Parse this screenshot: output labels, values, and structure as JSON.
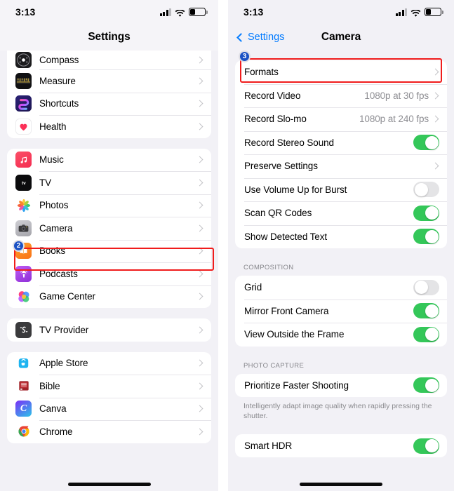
{
  "left_phone": {
    "status": {
      "time": "3:13",
      "signal_icon": "cellular-bars-icon",
      "wifi_icon": "wifi-icon",
      "battery_icon": "battery-low-icon"
    },
    "nav": {
      "title": "Settings"
    },
    "groups": [
      {
        "rows": [
          {
            "label": "Compass",
            "icon": "compass-app-icon",
            "partial": true
          },
          {
            "label": "Measure",
            "icon": "measure-app-icon"
          },
          {
            "label": "Shortcuts",
            "icon": "shortcuts-app-icon"
          },
          {
            "label": "Health",
            "icon": "health-app-icon"
          }
        ]
      },
      {
        "rows": [
          {
            "label": "Music",
            "icon": "music-app-icon"
          },
          {
            "label": "TV",
            "icon": "tv-app-icon"
          },
          {
            "label": "Photos",
            "icon": "photos-app-icon"
          },
          {
            "label": "Camera",
            "icon": "camera-app-icon",
            "highlighted": true
          },
          {
            "label": "Books",
            "icon": "books-app-icon"
          },
          {
            "label": "Podcasts",
            "icon": "podcasts-app-icon"
          },
          {
            "label": "Game Center",
            "icon": "game-center-app-icon"
          }
        ]
      },
      {
        "rows": [
          {
            "label": "TV Provider",
            "icon": "tv-provider-app-icon"
          }
        ]
      },
      {
        "rows": [
          {
            "label": "Apple Store",
            "icon": "apple-store-app-icon"
          },
          {
            "label": "Bible",
            "icon": "bible-app-icon"
          },
          {
            "label": "Canva",
            "icon": "canva-app-icon"
          },
          {
            "label": "Chrome",
            "icon": "chrome-app-icon"
          }
        ]
      }
    ],
    "badge": "2"
  },
  "right_phone": {
    "status": {
      "time": "3:13",
      "signal_icon": "cellular-bars-icon",
      "wifi_icon": "wifi-icon",
      "battery_icon": "battery-low-icon"
    },
    "nav": {
      "back_label": "Settings",
      "title": "Camera"
    },
    "badge": "3",
    "group1": [
      {
        "label": "Formats",
        "type": "disclosure",
        "highlighted": true
      },
      {
        "label": "Record Video",
        "type": "value",
        "value": "1080p at 30 fps"
      },
      {
        "label": "Record Slo-mo",
        "type": "value",
        "value": "1080p at 240 fps"
      },
      {
        "label": "Record Stereo Sound",
        "type": "toggle",
        "on": true
      },
      {
        "label": "Preserve Settings",
        "type": "disclosure"
      },
      {
        "label": "Use Volume Up for Burst",
        "type": "toggle",
        "on": false
      },
      {
        "label": "Scan QR Codes",
        "type": "toggle",
        "on": true
      },
      {
        "label": "Show Detected Text",
        "type": "toggle",
        "on": true
      }
    ],
    "section_composition": "COMPOSITION",
    "group2": [
      {
        "label": "Grid",
        "type": "toggle",
        "on": false
      },
      {
        "label": "Mirror Front Camera",
        "type": "toggle",
        "on": true
      },
      {
        "label": "View Outside the Frame",
        "type": "toggle",
        "on": true
      }
    ],
    "section_photo_capture": "PHOTO CAPTURE",
    "group3": [
      {
        "label": "Prioritize Faster Shooting",
        "type": "toggle",
        "on": true
      }
    ],
    "footnote": "Intelligently adapt image quality when rapidly pressing the shutter.",
    "group4": [
      {
        "label": "Smart HDR",
        "type": "toggle",
        "on": true
      }
    ]
  },
  "colors": {
    "accent": "#007aff",
    "toggle_on": "#34c759",
    "highlight": "#f01c1c",
    "badge": "#1b52c4"
  }
}
